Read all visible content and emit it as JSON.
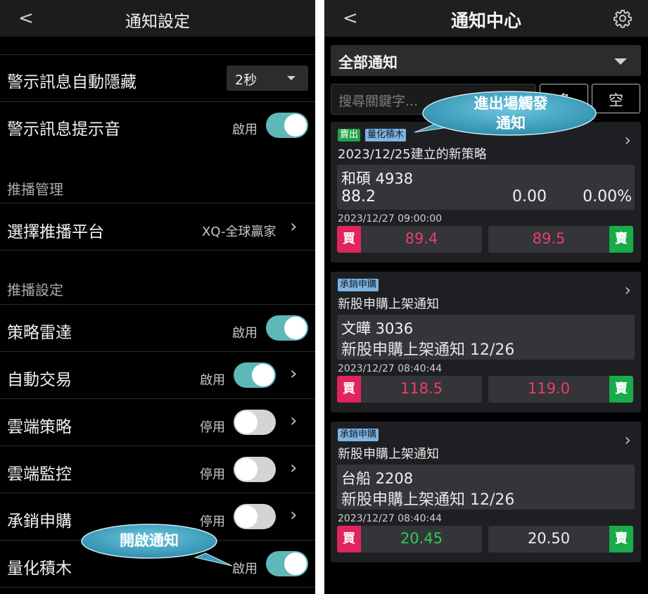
{
  "left": {
    "header": {
      "back": "<",
      "title": "通知設定"
    },
    "rows": [
      {
        "label": "警示訊息自動隱藏",
        "dropdown": "2秒"
      },
      {
        "label": "警示訊息提示音",
        "state": "啟用"
      }
    ],
    "push_mgmt": {
      "section": "推播管理",
      "label": "選擇推播平台",
      "value": "XQ-全球贏家"
    },
    "push_settings": {
      "section": "推播設定",
      "items": [
        {
          "label": "策略雷達",
          "state": "啟用"
        },
        {
          "label": "自動交易",
          "state": "啟用"
        },
        {
          "label": "雲端策略",
          "state": "停用"
        },
        {
          "label": "雲端監控",
          "state": "停用"
        },
        {
          "label": "承銷申購",
          "state": "停用"
        },
        {
          "label": "量化積木",
          "state": "啟用"
        }
      ]
    },
    "callout": "開啟通知"
  },
  "right": {
    "header": {
      "back": "<",
      "title": "通知中心"
    },
    "filter": "全部通知",
    "search": {
      "placeholder": "搜尋關鍵字..."
    },
    "buttons": [
      "多",
      "空"
    ],
    "callout_line1": "進出場觸發",
    "callout_line2": "通知",
    "cards": [
      {
        "tags": [
          "賣出",
          "量化積木"
        ],
        "title": "2023/12/25建立的新策略",
        "stock": "和碩 4938",
        "price": "88.2",
        "change": "0.00",
        "pct": "0.00%",
        "time": "2023/12/27 09:00:00",
        "buy_badge": "買",
        "buy": "89.4",
        "sell": "89.5",
        "sell_badge": "賣"
      },
      {
        "tags": [
          "承銷申購"
        ],
        "title": "新股申購上架通知",
        "stock": "文曄 3036",
        "desc": "新股申購上架通知 12/26",
        "time": "2023/12/27 08:40:44",
        "buy_badge": "買",
        "buy": "118.5",
        "sell": "119.0",
        "sell_badge": "賣"
      },
      {
        "tags": [
          "承銷申購"
        ],
        "title": "新股申購上架通知",
        "stock": "台船 2208",
        "desc": "新股申購上架通知 12/26",
        "time": "2023/12/27 08:40:44",
        "buy_badge": "買",
        "buy": "20.45",
        "sell": "20.50",
        "sell_badge": "賣"
      }
    ]
  },
  "colors": {
    "accent": "#5fb8b8",
    "buy": "#e0245e",
    "sell": "#1aab4a",
    "callout": "#3ea6c4"
  }
}
